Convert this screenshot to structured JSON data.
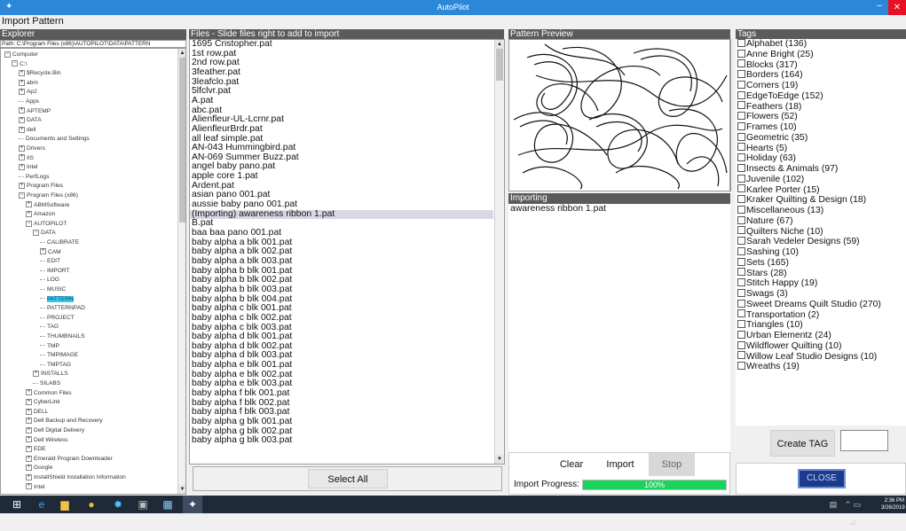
{
  "window": {
    "title": "AutoPilot",
    "subtitle": "Import Pattern",
    "min_glyph": "–",
    "close_glyph": "✕"
  },
  "explorer": {
    "header": "Explorer",
    "path": "Path: C:\\Program Files (x86)\\AUTOPILOT\\DATA\\PATTERN",
    "items": [
      {
        "label": "Computer",
        "exp": "−",
        "indent": 0
      },
      {
        "label": "C:\\",
        "exp": "−",
        "indent": 1
      },
      {
        "label": "$Recycle.Bin",
        "exp": "+",
        "indent": 2
      },
      {
        "label": "abm",
        "exp": "+",
        "indent": 2
      },
      {
        "label": "Ap2",
        "exp": "+",
        "indent": 2
      },
      {
        "label": "Apps",
        "exp": "",
        "indent": 2
      },
      {
        "label": "APTEMP",
        "exp": "+",
        "indent": 2
      },
      {
        "label": "DATA",
        "exp": "+",
        "indent": 2
      },
      {
        "label": "dell",
        "exp": "+",
        "indent": 2
      },
      {
        "label": "Documents and Settings",
        "exp": "",
        "indent": 2
      },
      {
        "label": "Drivers",
        "exp": "+",
        "indent": 2
      },
      {
        "label": "IIS",
        "exp": "+",
        "indent": 2
      },
      {
        "label": "Intel",
        "exp": "+",
        "indent": 2
      },
      {
        "label": "PerfLogs",
        "exp": "",
        "indent": 2
      },
      {
        "label": "Program Files",
        "exp": "+",
        "indent": 2
      },
      {
        "label": "Program Files (x86)",
        "exp": "−",
        "indent": 2
      },
      {
        "label": "ABMSoftware",
        "exp": "+",
        "indent": 3
      },
      {
        "label": "Amazon",
        "exp": "+",
        "indent": 3
      },
      {
        "label": "AUTOPILOT",
        "exp": "−",
        "indent": 3
      },
      {
        "label": "DATA",
        "exp": "−",
        "indent": 4
      },
      {
        "label": "CALIBRATE",
        "exp": "",
        "indent": 5
      },
      {
        "label": "CAM",
        "exp": "+",
        "indent": 5
      },
      {
        "label": "EDIT",
        "exp": "",
        "indent": 5
      },
      {
        "label": "IMPORT",
        "exp": "",
        "indent": 5
      },
      {
        "label": "LOG",
        "exp": "",
        "indent": 5
      },
      {
        "label": "MUSIC",
        "exp": "",
        "indent": 5
      },
      {
        "label": "PATTERN",
        "exp": "",
        "indent": 5,
        "selected": true
      },
      {
        "label": "PATTERNPAD",
        "exp": "",
        "indent": 5
      },
      {
        "label": "PROJECT",
        "exp": "",
        "indent": 5
      },
      {
        "label": "TAG",
        "exp": "",
        "indent": 5
      },
      {
        "label": "THUMBNAILS",
        "exp": "",
        "indent": 5
      },
      {
        "label": "TMP",
        "exp": "",
        "indent": 5
      },
      {
        "label": "TMPIMAGE",
        "exp": "",
        "indent": 5
      },
      {
        "label": "TMPTAG",
        "exp": "",
        "indent": 5
      },
      {
        "label": "INSTALLS",
        "exp": "+",
        "indent": 4
      },
      {
        "label": "SILABS",
        "exp": "",
        "indent": 4
      },
      {
        "label": "Common Files",
        "exp": "+",
        "indent": 3
      },
      {
        "label": "CyberLink",
        "exp": "+",
        "indent": 3
      },
      {
        "label": "DELL",
        "exp": "+",
        "indent": 3
      },
      {
        "label": "Dell Backup and Recovery",
        "exp": "+",
        "indent": 3
      },
      {
        "label": "Dell Digital Delivery",
        "exp": "+",
        "indent": 3
      },
      {
        "label": "Dell Wireless",
        "exp": "+",
        "indent": 3
      },
      {
        "label": "EDE",
        "exp": "+",
        "indent": 3
      },
      {
        "label": "Emerald Program Downloader",
        "exp": "+",
        "indent": 3
      },
      {
        "label": "Google",
        "exp": "+",
        "indent": 3
      },
      {
        "label": "InstallShield Installation Information",
        "exp": "+",
        "indent": 3
      },
      {
        "label": "Intel",
        "exp": "+",
        "indent": 3
      }
    ]
  },
  "files": {
    "header": "Files - Slide files right to add to import",
    "select_all": "Select All",
    "items": [
      "1695 Cristopher.pat",
      "1st row.pat",
      "2nd row.pat",
      "3feather.pat",
      "3leafclo.pat",
      "5lfclvr.pat",
      "A.pat",
      "abc.pat",
      "Alienfleur-UL-Lcrnr.pat",
      "AlienfleurBrdr.pat",
      "all leaf simple.pat",
      "AN-043 Hummingbird.pat",
      "AN-069 Summer Buzz.pat",
      "angel baby pano.pat",
      "apple core 1.pat",
      "Ardent.pat",
      "asian pano 001.pat",
      "aussie baby pano 001.pat",
      "(Importing)  awareness ribbon 1.pat",
      "B.pat",
      "baa baa pano 001.pat",
      "baby alpha a blk 001.pat",
      "baby alpha a blk 002.pat",
      "baby alpha a blk 003.pat",
      "baby alpha b blk 001.pat",
      "baby alpha b blk 002.pat",
      "baby alpha b blk 003.pat",
      "baby alpha b blk 004.pat",
      "baby alpha c blk 001.pat",
      "baby alpha c blk 002.pat",
      "baby alpha c blk 003.pat",
      "baby alpha d blk 001.pat",
      "baby alpha d blk 002.pat",
      "baby alpha d blk 003.pat",
      "baby alpha e blk 001.pat",
      "baby alpha e blk 002.pat",
      "baby alpha e blk 003.pat",
      "baby alpha f blk 001.pat",
      "baby alpha f blk 002.pat",
      "baby alpha f blk 003.pat",
      "baby alpha g blk 001.pat",
      "baby alpha g blk 002.pat",
      "baby alpha g blk 003.pat"
    ],
    "highlighted_index": 18
  },
  "preview": {
    "header": "Pattern Preview"
  },
  "importing": {
    "header": "Importing",
    "items": [
      "awareness ribbon 1.pat"
    ]
  },
  "actions": {
    "clear": "Clear",
    "import": "Import",
    "stop": "Stop",
    "progress_label": "Import Progress:",
    "progress_text": "100%",
    "progress_value": 1.0
  },
  "tags": {
    "header": "Tags",
    "create_label": "Create TAG",
    "close_label": "CLOSE",
    "items": [
      "Alphabet (136)",
      "Anne Bright (25)",
      "Blocks (317)",
      "Borders (164)",
      "Corners (19)",
      "EdgeToEdge (152)",
      "Feathers (18)",
      "Flowers (52)",
      "Frames (10)",
      "Geometric (35)",
      "Hearts (5)",
      "Holiday (63)",
      "Insects & Animals (97)",
      "Juvenile (102)",
      "Karlee Porter (15)",
      "Kraker Quilting & Design (18)",
      "Miscellaneous (13)",
      "Nature (67)",
      "Quilters Niche (10)",
      "Sarah Vedeler Designs (59)",
      "Sashing (10)",
      "Sets (165)",
      "Stars (28)",
      "Stitch Happy (19)",
      "Swags (3)",
      "Sweet Dreams Quilt Studio (270)",
      "Transportation (2)",
      "Triangles (10)",
      "Urban Elementz (24)",
      "Wildflower Quilting (10)",
      "Willow Leaf Studio Designs (10)",
      "Wreaths (19)"
    ]
  },
  "taskbar": {
    "time": "2:36 PM",
    "date": "3/26/2019"
  },
  "colors": {
    "accent": "#2b88d8",
    "progress": "#19d45a",
    "selected": "#33ccff",
    "close_btn": "#1c3b8c"
  }
}
